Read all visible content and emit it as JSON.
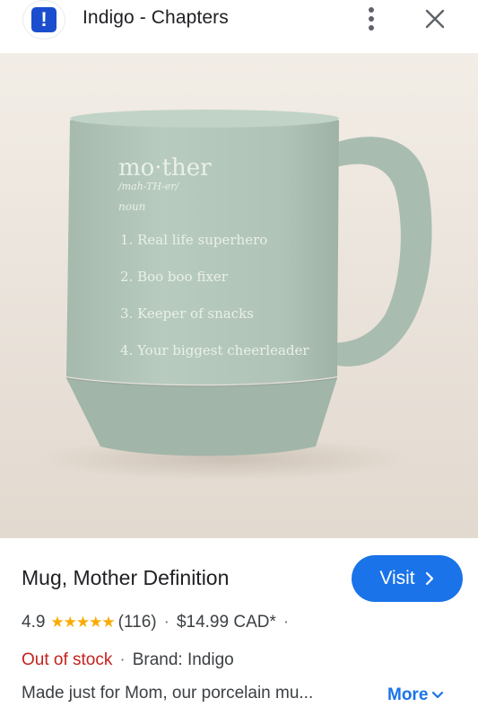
{
  "header": {
    "site_name": "Indigo - Chapters",
    "logo_glyph": "!",
    "menu_icon": "more-vert-icon",
    "close_icon": "close-icon"
  },
  "image": {
    "mug_text": {
      "word": "mo·ther",
      "pronunciation": "/mah-TH-er/",
      "part_of_speech": "noun",
      "items": [
        "1. Real life superhero",
        "2. Boo boo fixer",
        "3. Keeper of snacks",
        "4. Your biggest cheerleader"
      ]
    }
  },
  "product": {
    "title": "Mug, Mother Definition",
    "visit_label": "Visit",
    "rating": "4.9",
    "stars": 5,
    "reviews": "(116)",
    "price": "$14.99 CAD*",
    "trailing_sep": "·",
    "stock": "Out of stock",
    "brand": "Brand: Indigo",
    "description": "Made just for Mom, our porcelain mu...",
    "more_label": "More"
  },
  "colors": {
    "accent": "#1a73e8",
    "star": "#f9ab00",
    "out_of_stock": "#c5221f",
    "logo_bg": "#1a4ecf",
    "mug": "#b3c6ba",
    "background": "#ede8e0"
  }
}
